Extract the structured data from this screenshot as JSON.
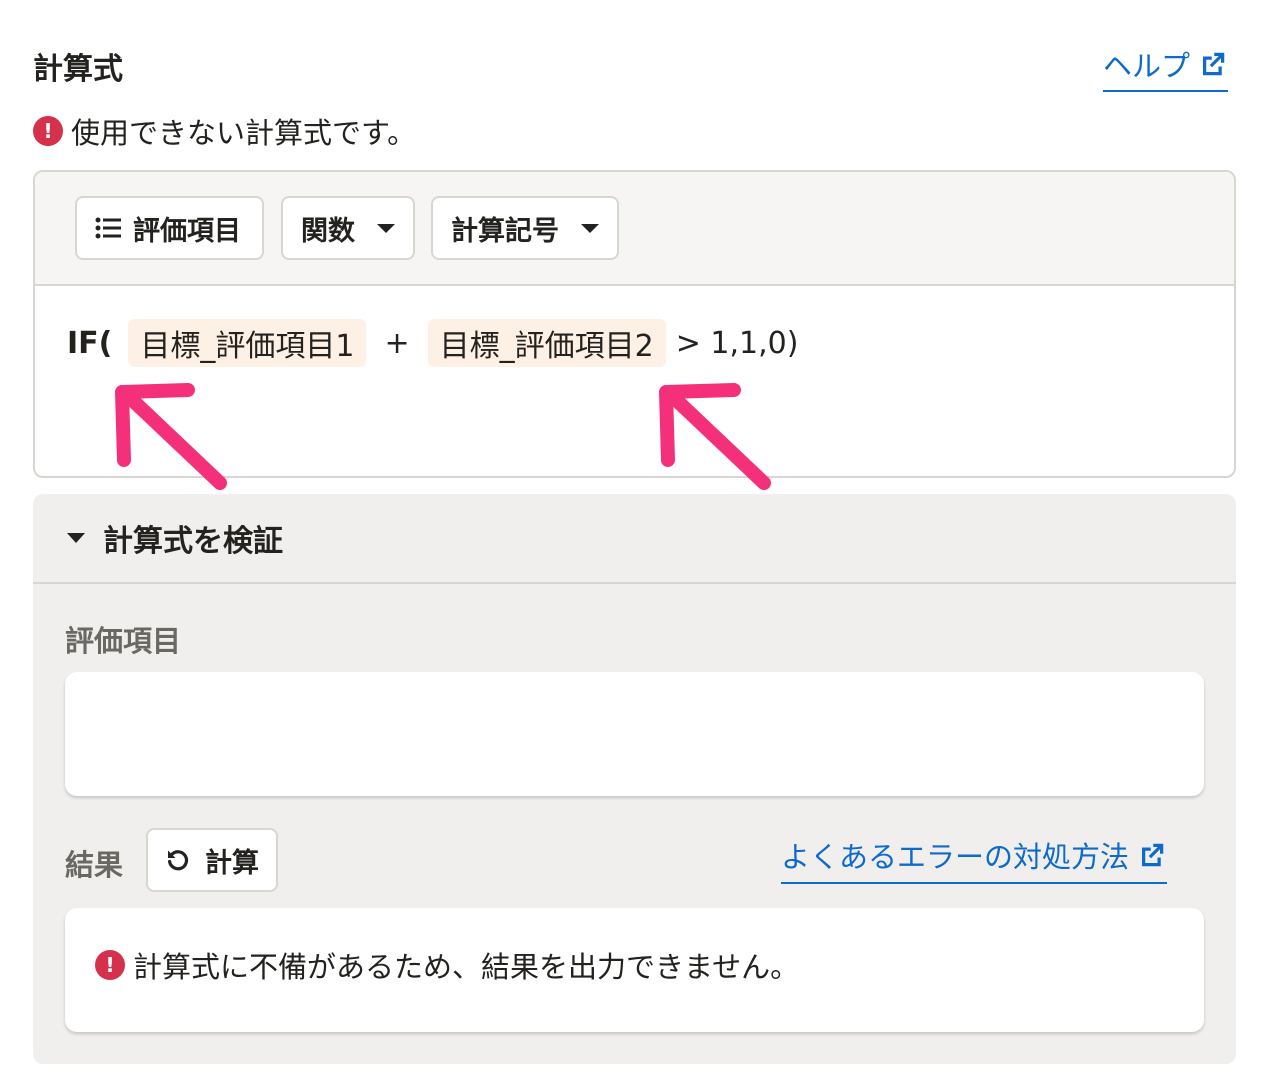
{
  "header": {
    "title": "計算式",
    "help_label": "ヘルプ"
  },
  "error_message": "使用できない計算式です。",
  "toolbar": {
    "evaluation_items_label": "評価項目",
    "functions_label": "関数",
    "operators_label": "計算記号"
  },
  "formula": {
    "prefix": "IF(",
    "token1": "目標_評価項目1",
    "operator": "+",
    "token2": "目標_評価項目2",
    "suffix": "> 1,1,0)"
  },
  "verify": {
    "heading": "計算式を検証",
    "items_label": "評価項目",
    "result_label": "結果",
    "calc_button_label": "計算",
    "faq_link_label": "よくあるエラーの対処方法",
    "result_error_message": "計算式に不備があるため、結果を出力できません。"
  },
  "colors": {
    "link": "#0f6bcb",
    "error": "#d5314d",
    "annotation_arrow": "#f5307a",
    "chip_bg": "#fdf1e6"
  },
  "icons": [
    "external-link-icon",
    "error-icon",
    "list-icon",
    "caret-down-icon",
    "refresh-icon"
  ]
}
